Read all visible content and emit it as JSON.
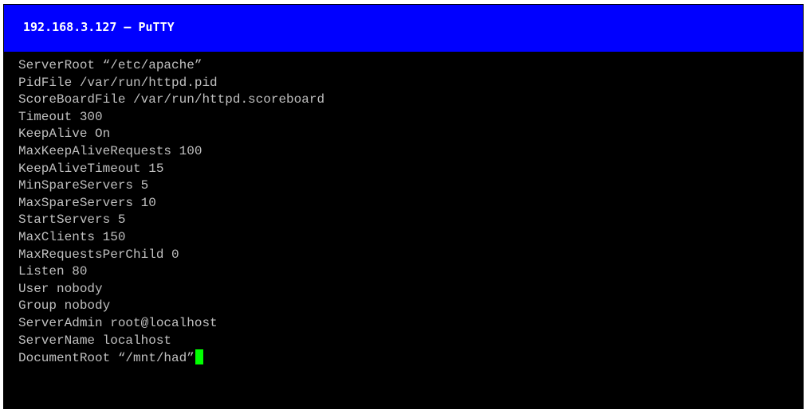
{
  "window": {
    "title": "192.168.3.127 – PuTTY"
  },
  "terminal": {
    "lines": [
      "ServerRoot “/etc/apache”",
      "PidFile /var/run/httpd.pid",
      "ScoreBoardFile /var/run/httpd.scoreboard",
      "Timeout 300",
      "KeepAlive On",
      "MaxKeepAliveRequests 100",
      "KeepAliveTimeout 15",
      "MinSpareServers 5",
      "MaxSpareServers 10",
      "StartServers 5",
      "MaxClients 150",
      "MaxRequestsPerChild 0",
      "Listen 80",
      "User nobody",
      "Group nobody",
      "ServerAdmin root@localhost",
      "ServerName localhost",
      "DocumentRoot “/mnt/had”"
    ]
  },
  "colors": {
    "titlebar_bg": "#0000ff",
    "title_fg": "#ffffff",
    "terminal_bg": "#000000",
    "terminal_fg": "#c0c0c0",
    "cursor": "#00ff00"
  }
}
